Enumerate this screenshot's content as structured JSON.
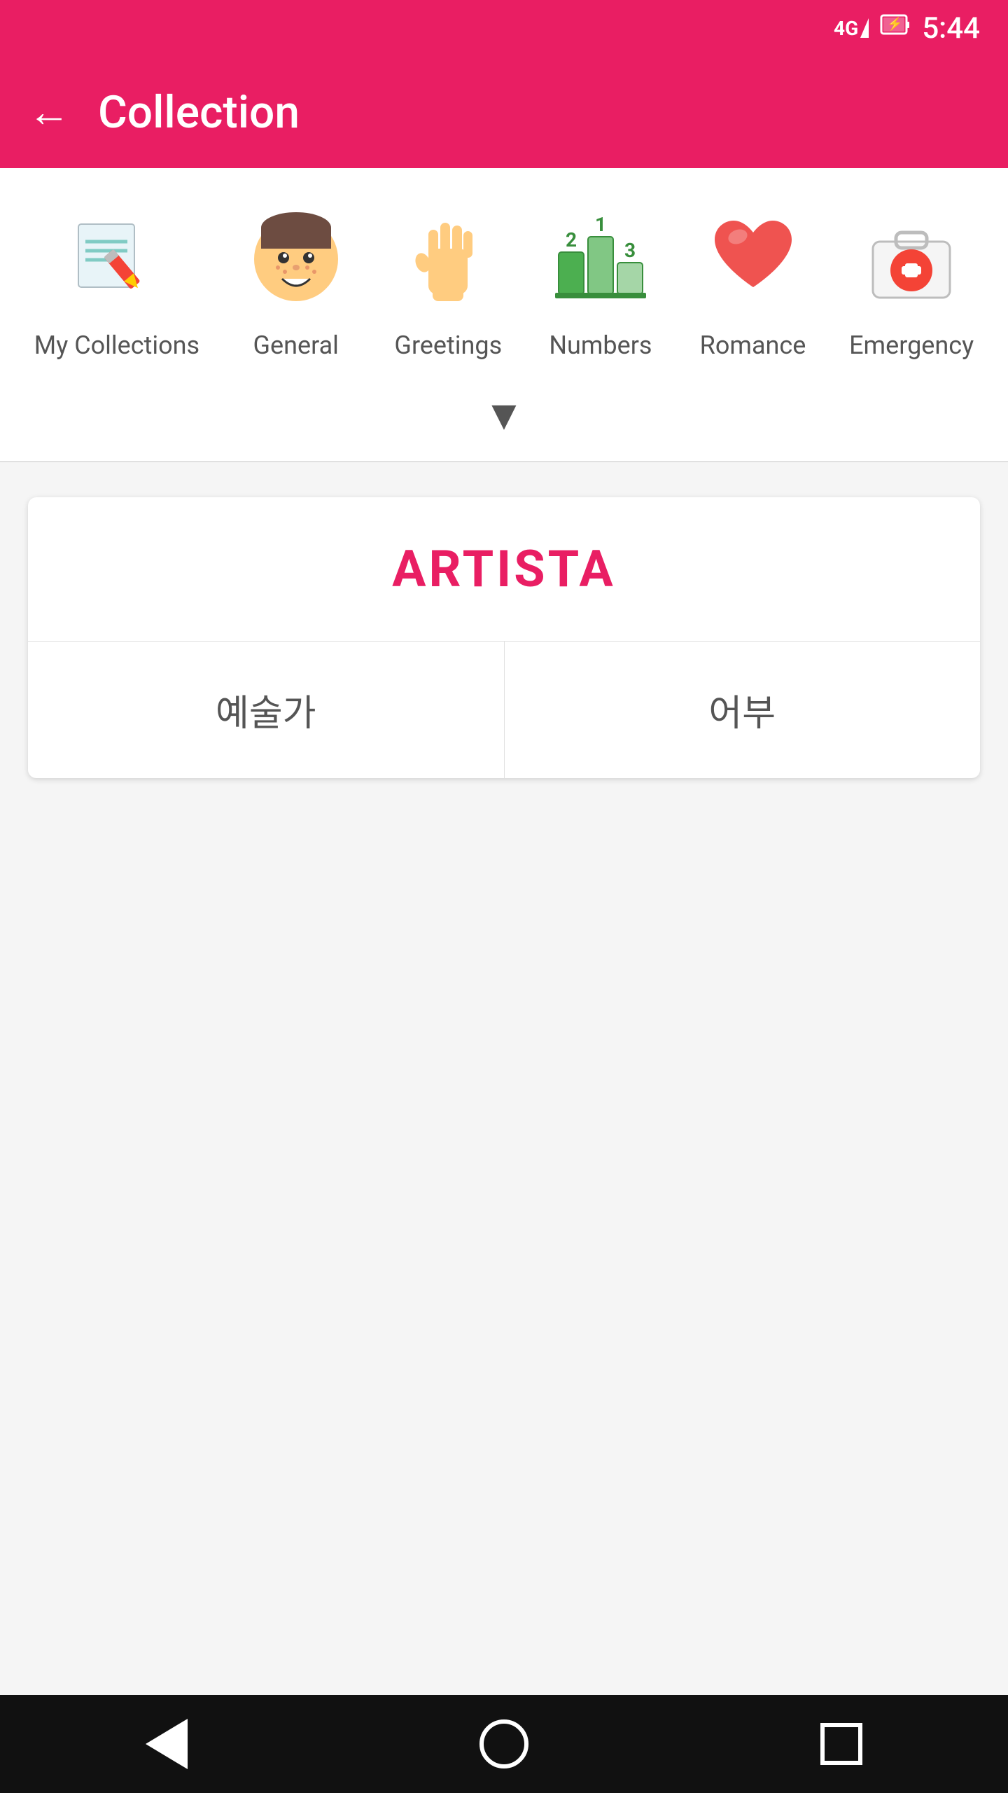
{
  "statusBar": {
    "time": "5:44",
    "signal": "4G",
    "battery": "charging"
  },
  "appBar": {
    "title": "Collection",
    "backLabel": "←"
  },
  "categories": [
    {
      "id": "my-collections",
      "label": "My Collections",
      "icon": "notebook-pencil"
    },
    {
      "id": "general",
      "label": "General",
      "icon": "smiley-face"
    },
    {
      "id": "greetings",
      "label": "Greetings",
      "icon": "hand-wave"
    },
    {
      "id": "numbers",
      "label": "Numbers",
      "icon": "podium-numbers"
    },
    {
      "id": "romance",
      "label": "Romance",
      "icon": "heart"
    },
    {
      "id": "emergency",
      "label": "Emergency",
      "icon": "first-aid-kit"
    }
  ],
  "chevron": "▼",
  "flashcard": {
    "word": "ARTISTA",
    "choice1": "예술가",
    "choice2": "어부"
  },
  "navbar": {
    "back": "back",
    "home": "home",
    "recents": "recents"
  }
}
